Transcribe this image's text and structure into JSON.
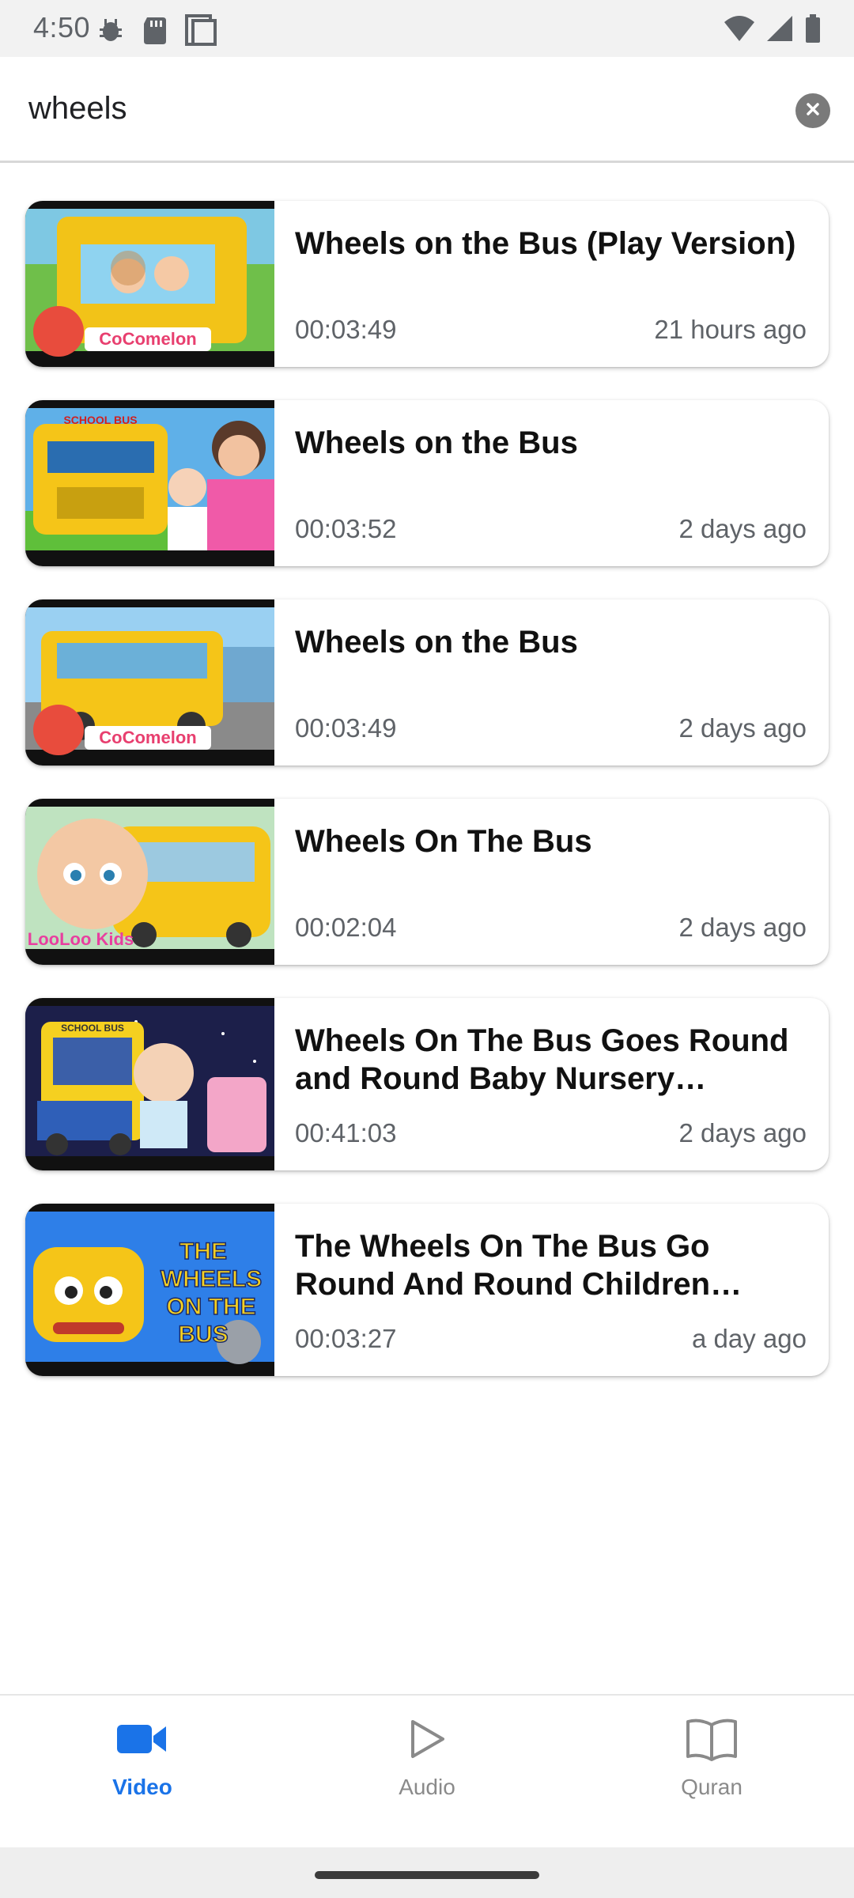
{
  "status_bar": {
    "time": "4:50",
    "left_icons": [
      "debug-icon",
      "sd-card-icon",
      "screenshot-icon"
    ],
    "right_icons": [
      "wifi-icon",
      "cellular-signal-icon",
      "battery-icon"
    ]
  },
  "search": {
    "query": "wheels",
    "clear_icon": "clear-circle-icon"
  },
  "videos": [
    {
      "title": "Wheels on the Bus (Play Version)",
      "duration": "00:03:49",
      "age": "21 hours ago",
      "thumb_logo": "CoComelon"
    },
    {
      "title": "Wheels on the Bus",
      "duration": "00:03:52",
      "age": "2 days ago",
      "thumb_logo": "SCHOOL BUS"
    },
    {
      "title": "Wheels on the Bus",
      "duration": "00:03:49",
      "age": "2 days ago",
      "thumb_logo": "CoComelon"
    },
    {
      "title": "Wheels On The Bus",
      "duration": "00:02:04",
      "age": "2 days ago",
      "thumb_logo": "LooLoo Kids"
    },
    {
      "title": "Wheels On The Bus Goes Round and Round Baby Nursery Rhyme…",
      "duration": "00:41:03",
      "age": "2 days ago",
      "thumb_logo": "SCHOOL BUS"
    },
    {
      "title": "The Wheels On The Bus Go Round And Round Children Rhyme with l…",
      "duration": "00:03:27",
      "age": "a day ago",
      "thumb_logo": "THE WHEELS ON THE BUS"
    }
  ],
  "bottom_nav": [
    {
      "label": "Video",
      "icon": "video-camera-icon",
      "active": true,
      "color": "#1a73e8"
    },
    {
      "label": "Audio",
      "icon": "play-outline-icon",
      "active": false,
      "color": "#8a8a8a"
    },
    {
      "label": "Quran",
      "icon": "open-book-icon",
      "active": false,
      "color": "#8a8a8a"
    }
  ]
}
